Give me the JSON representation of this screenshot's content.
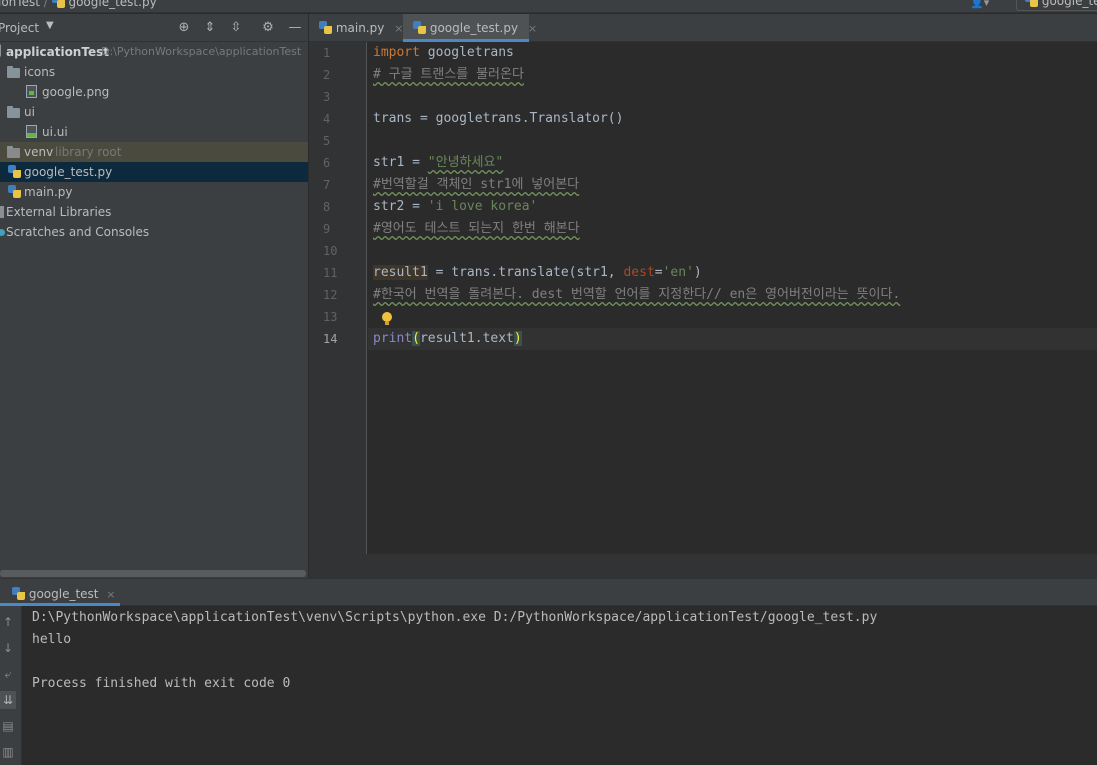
{
  "navbar": {
    "project": "ionTest",
    "separator": "/",
    "file": "google_test.py",
    "user_icon": "user-icon",
    "run_config": "google_te"
  },
  "project_panel": {
    "title": "Project",
    "dropdown": "▼",
    "header_icons": [
      "locate-icon",
      "expand-all-icon",
      "collapse-all-icon",
      "gear-icon",
      "minimize-icon"
    ],
    "tree": [
      {
        "label": "applicationTest",
        "hint": "D:\\PythonWorkspace\\applicationTest",
        "icon": "folder-icon"
      },
      {
        "label": "icons",
        "hint": "",
        "icon": "folder-icon"
      },
      {
        "label": "google.png",
        "hint": "",
        "icon": "image-file-icon"
      },
      {
        "label": "ui",
        "hint": "",
        "icon": "folder-icon"
      },
      {
        "label": "ui.ui",
        "hint": "",
        "icon": "ui-file-icon"
      },
      {
        "label": "venv",
        "hint": "library root",
        "icon": "folder-icon"
      },
      {
        "label": "google_test.py",
        "hint": "",
        "icon": "python-file-icon"
      },
      {
        "label": "main.py",
        "hint": "",
        "icon": "python-file-icon"
      },
      {
        "label": "External Libraries",
        "hint": "",
        "icon": "library-icon"
      },
      {
        "label": "Scratches and Consoles",
        "hint": "",
        "icon": "scratches-icon"
      }
    ]
  },
  "editor": {
    "tabs": [
      {
        "label": "main.py",
        "close": "×"
      },
      {
        "label": "google_test.py",
        "close": "×"
      }
    ],
    "line_numbers": [
      "1",
      "2",
      "3",
      "4",
      "5",
      "6",
      "7",
      "8",
      "9",
      "10",
      "11",
      "12",
      "13",
      "14"
    ],
    "code": {
      "l1_kw": "import",
      "l1_rest": " googletrans",
      "l2": "# 구글 트랜스를 불러온다",
      "l4": "trans = googletrans.Translator()",
      "l6_a": "str1 = ",
      "l6_str": "\"안녕하세요\"",
      "l7": "#번역할걸 객체인 str1에 넣어본다",
      "l8_a": "str2 = ",
      "l8_str": "'i love korea'",
      "l9": "#영어도 테스트 되는지 한번 해본다",
      "l11_var": "result1",
      "l11_a": " = trans.translate(str1, ",
      "l11_param": "dest",
      "l11_b": "=",
      "l11_str": "'en'",
      "l11_c": ")",
      "l12": "#한국어 번역을 돌려본다. dest 번역할 언어를 지정한다// en은 영어버전이라는 뜻이다.",
      "l14_fn": "print",
      "l14_open": "(",
      "l14_mid": "result1.text",
      "l14_close": ")"
    }
  },
  "run_panel": {
    "tab": "google_test",
    "tab_close": "×",
    "toolbar_icons": [
      "up-arrow-icon",
      "down-arrow-icon",
      "soft-wrap-icon",
      "scroll-to-end-icon",
      "print-icon",
      "trash-icon"
    ],
    "output": [
      "D:\\PythonWorkspace\\applicationTest\\venv\\Scripts\\python.exe D:/PythonWorkspace/applicationTest/google_test.py",
      "hello",
      "",
      "Process finished with exit code 0"
    ]
  }
}
